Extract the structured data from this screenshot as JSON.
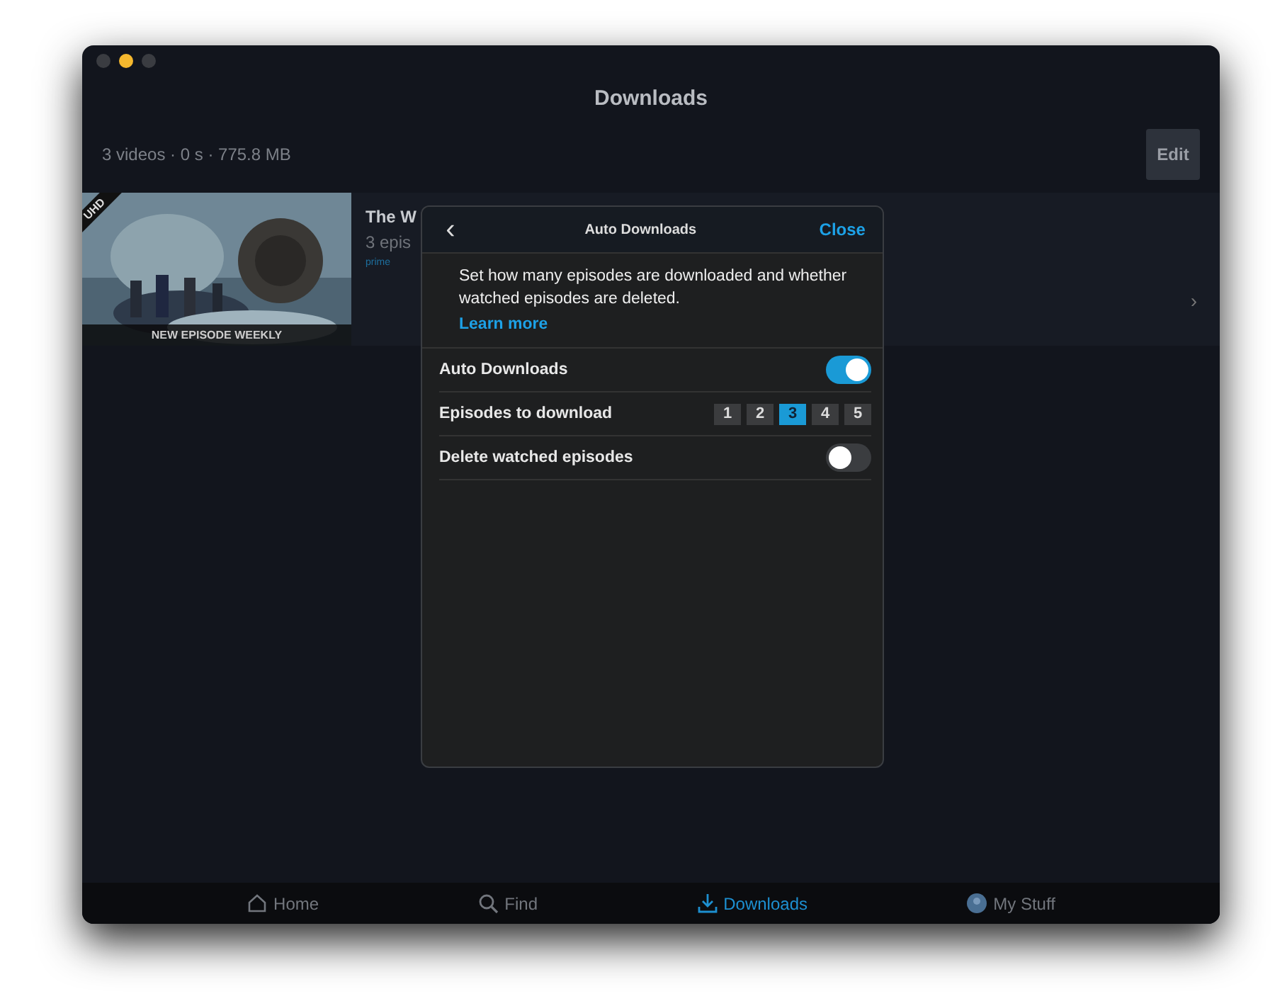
{
  "window": {
    "title": "Downloads",
    "controls": [
      {
        "active": false
      },
      {
        "active": true
      },
      {
        "active": false
      }
    ]
  },
  "summary": "3 videos · 0 s · 775.8 MB",
  "edit_button": "Edit",
  "downloads": [
    {
      "badge": "UHD",
      "caption": "NEW EPISODE WEEKLY",
      "title": "The W",
      "subtitle": "3 epis",
      "tag": "prime",
      "chevron": "›"
    }
  ],
  "dialog": {
    "back": "‹",
    "title": "Auto Downloads",
    "close": "Close",
    "description": "Set how many episodes are downloaded and whether watched episodes are deleted.",
    "link": "Learn more",
    "rows": [
      {
        "kind": "toggle",
        "label": "Auto Downloads",
        "on": true
      },
      {
        "kind": "choice",
        "label": "Episodes to download",
        "options": [
          {
            "label": "1",
            "selected": false
          },
          {
            "label": "2",
            "selected": false
          },
          {
            "label": "3",
            "selected": true
          },
          {
            "label": "4",
            "selected": false
          },
          {
            "label": "5",
            "selected": false
          }
        ]
      },
      {
        "kind": "toggle",
        "label": "Delete watched episodes",
        "on": false
      }
    ]
  },
  "tab_bar": [
    {
      "kind": "home",
      "label": "Home",
      "selected": false
    },
    {
      "kind": "find",
      "label": "Find",
      "selected": false
    },
    {
      "kind": "downloads",
      "label": "Downloads",
      "selected": true
    },
    {
      "kind": "profile",
      "label": "My Stuff",
      "selected": false
    }
  ]
}
